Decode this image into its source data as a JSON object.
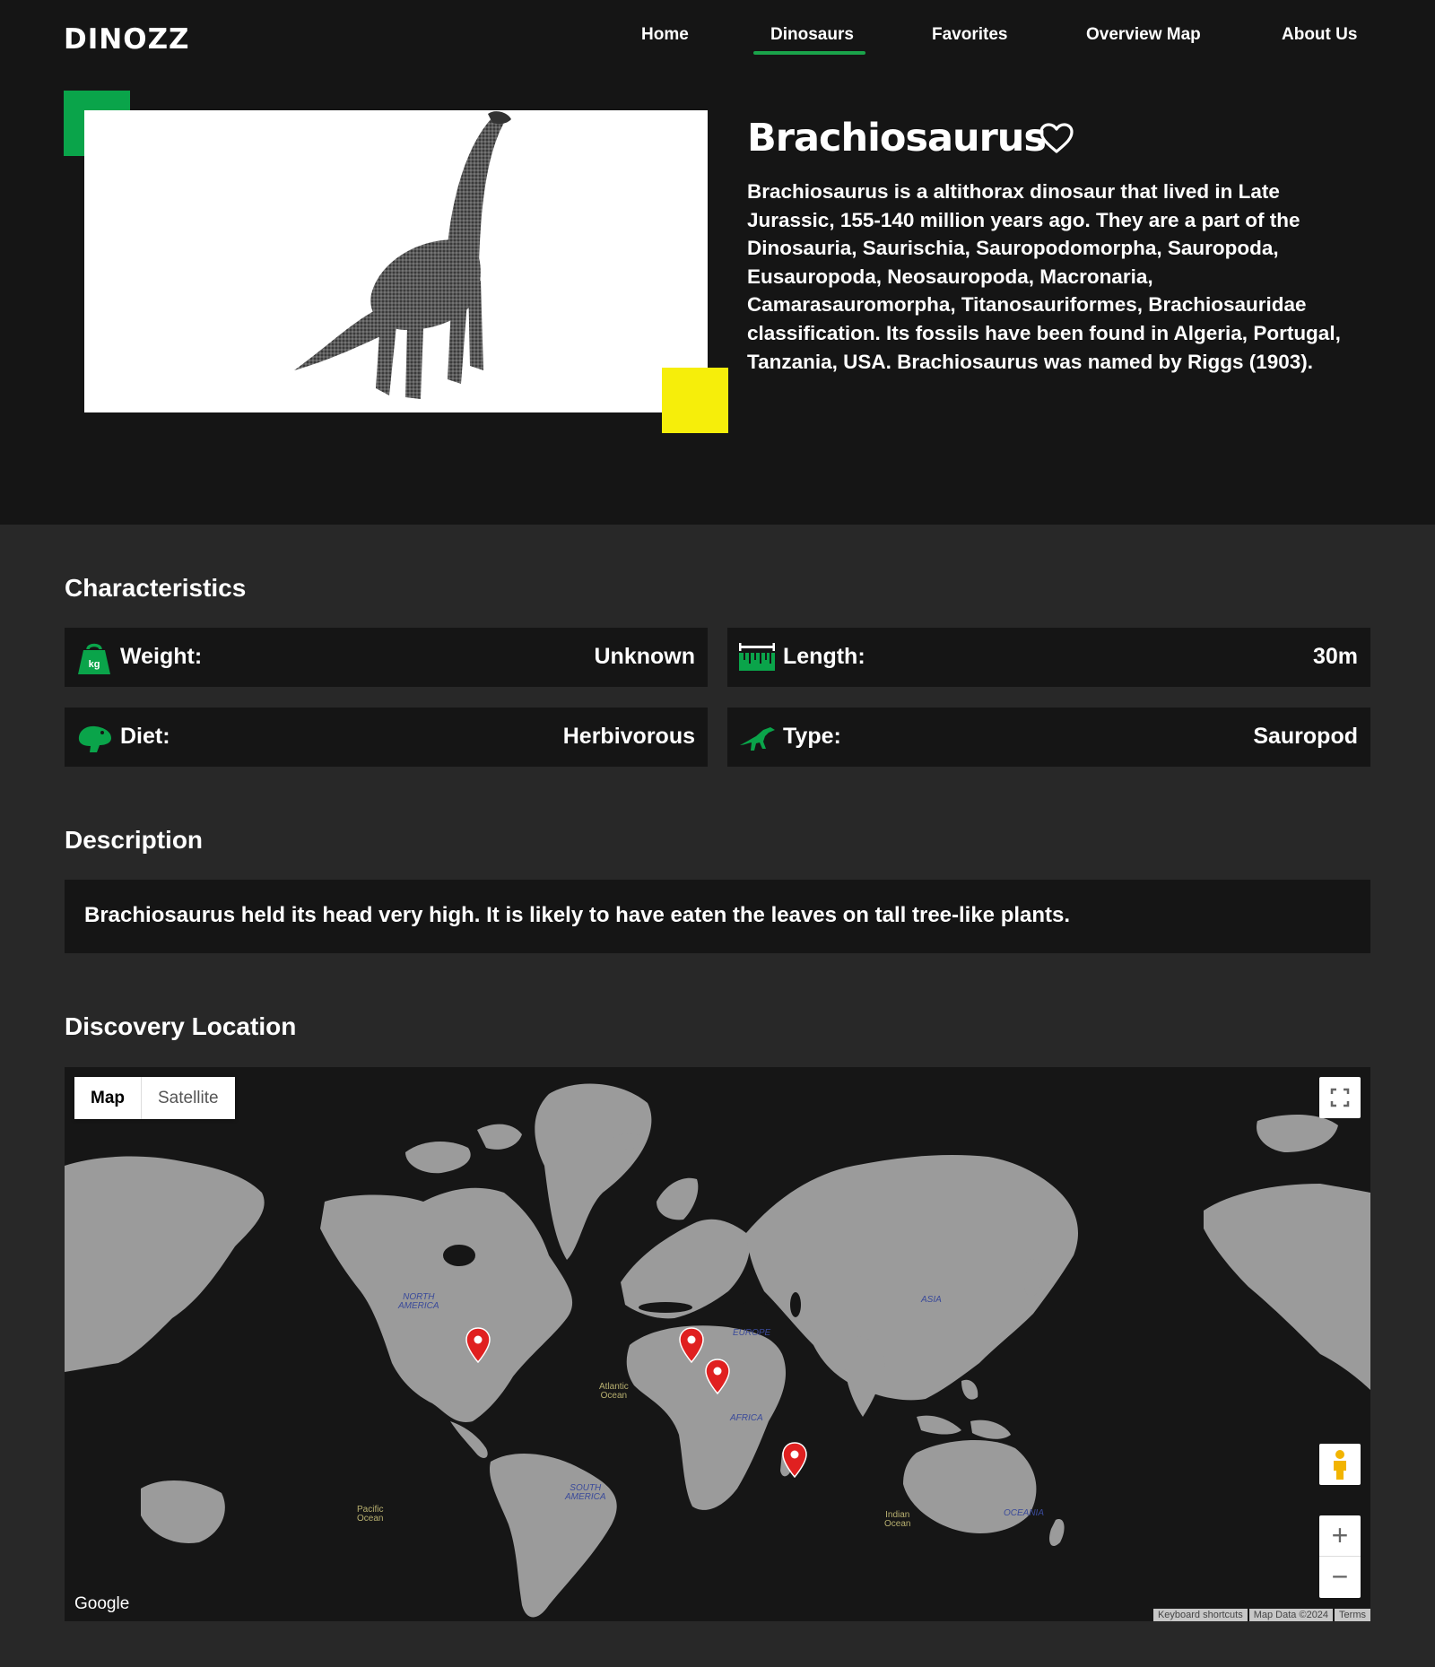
{
  "brand": {
    "logo": "DINOZZ"
  },
  "nav": [
    {
      "label": "Home"
    },
    {
      "label": "Dinosaurs",
      "active": true
    },
    {
      "label": "Favorites"
    },
    {
      "label": "Overview Map"
    },
    {
      "label": "About Us"
    }
  ],
  "dinosaur": {
    "name": "Brachiosaurus",
    "intro": "Brachiosaurus is a altithorax dinosaur that lived in Late Jurassic, 155-140 million years ago. They are a part of the Dinosauria, Saurischia, Sauropodomorpha, Sauropoda, Eusauropoda, Neosauropoda, Macronaria, Camarasauromorpha, Titanosauriformes, Brachiosauridae classification. Its fossils have been found in Algeria, Portugal, Tanzania, USA. Brachiosaurus was named by Riggs (1903)."
  },
  "characteristics": {
    "heading": "Characteristics",
    "weight": {
      "label": "Weight:",
      "value": "Unknown",
      "icon": "kg-weight-icon",
      "icon_text": "kg"
    },
    "length": {
      "label": "Length:",
      "value": "30m",
      "icon": "ruler-icon"
    },
    "diet": {
      "label": "Diet:",
      "value": "Herbivorous",
      "icon": "diet-icon"
    },
    "type": {
      "label": "Type:",
      "value": "Sauropod",
      "icon": "dinosaur-type-icon"
    }
  },
  "description": {
    "heading": "Description",
    "text": "Brachiosaurus held its head very high. It is likely to have eaten the leaves on tall tree-like plants."
  },
  "discovery": {
    "heading": "Discovery Location",
    "map": {
      "toggle": {
        "map": "Map",
        "satellite": "Satellite"
      },
      "google": "Google",
      "attribution": [
        "Keyboard shortcuts",
        "Map Data ©2024",
        "Terms"
      ],
      "labels": {
        "north_america": [
          "NORTH",
          "AMERICA"
        ],
        "south_america": [
          "SOUTH",
          "AMERICA"
        ],
        "europe": "EUROPE",
        "asia": "ASIA",
        "africa": "AFRICA",
        "oceania": "OCEANIA",
        "atlantic": [
          "Atlantic",
          "Ocean"
        ],
        "pacific": [
          "Pacific",
          "Ocean"
        ],
        "indian": [
          "Indian",
          "Ocean"
        ]
      },
      "markers": [
        "USA",
        "Portugal",
        "Algeria",
        "Tanzania"
      ]
    }
  },
  "colors": {
    "accent_green": "#0aa44a",
    "accent_yellow": "#f6ee0a",
    "marker_red": "#e02020"
  }
}
